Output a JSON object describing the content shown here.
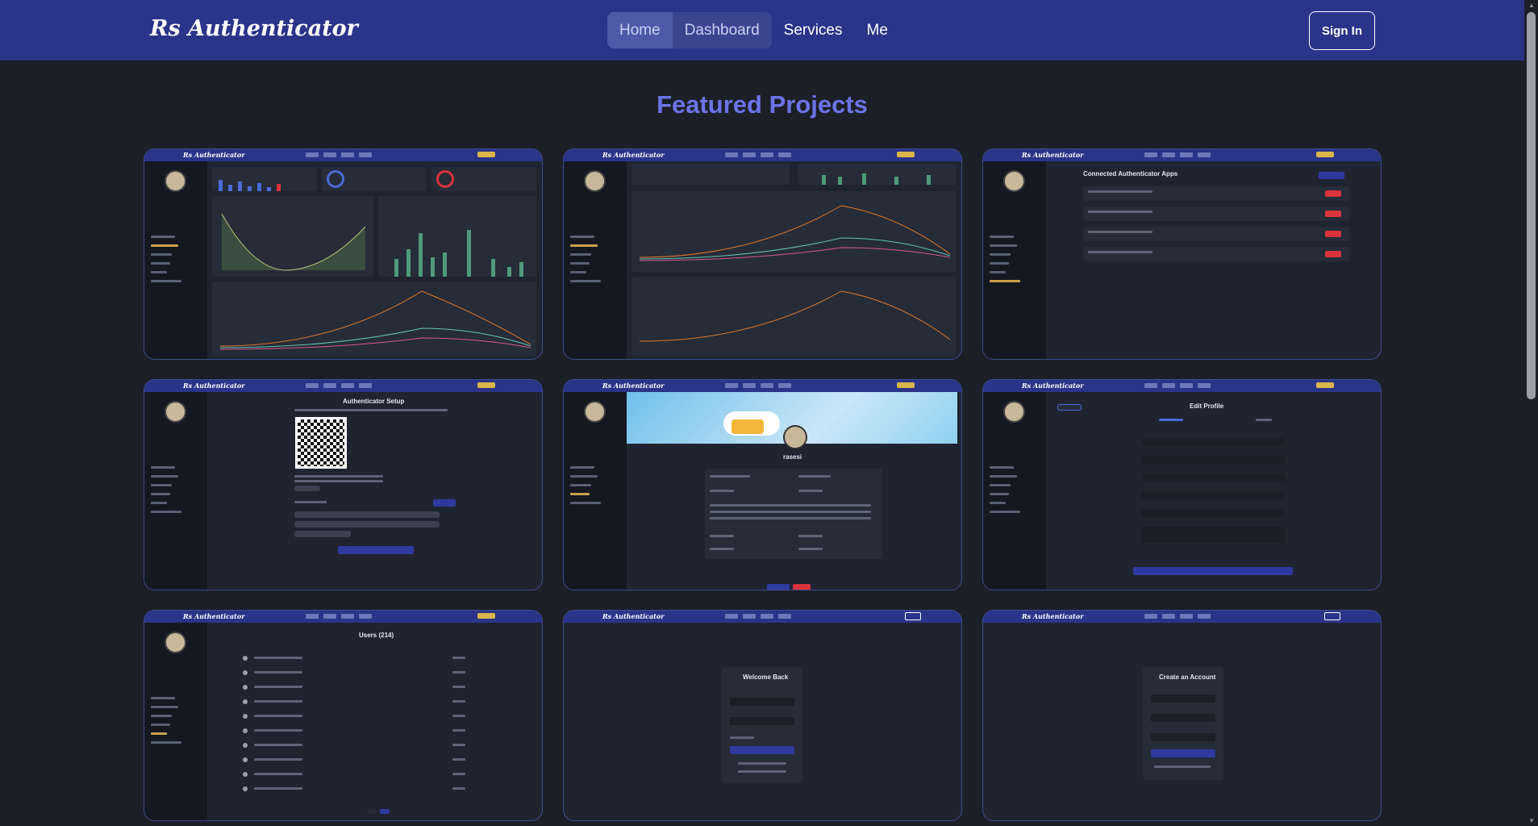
{
  "brand": "Rs Authenticator",
  "nav": {
    "links": [
      "Home",
      "Dashboard",
      "Services",
      "Me"
    ],
    "signin": "Sign In"
  },
  "heading": "Featured Projects",
  "cards": {
    "c3_title": "Connected Authenticator Apps",
    "c4_title": "Authenticator Setup",
    "c5_title": "rasesi",
    "c6_title": "Edit Profile",
    "c7_title": "Users (214)",
    "c8_title": "Welcome Back",
    "c9_title": "Create an Account"
  },
  "colors": {
    "navbar": "#2a3489",
    "accent": "#6b74e6",
    "background": "#1b1f27",
    "card_border": "#3d4d8f"
  }
}
